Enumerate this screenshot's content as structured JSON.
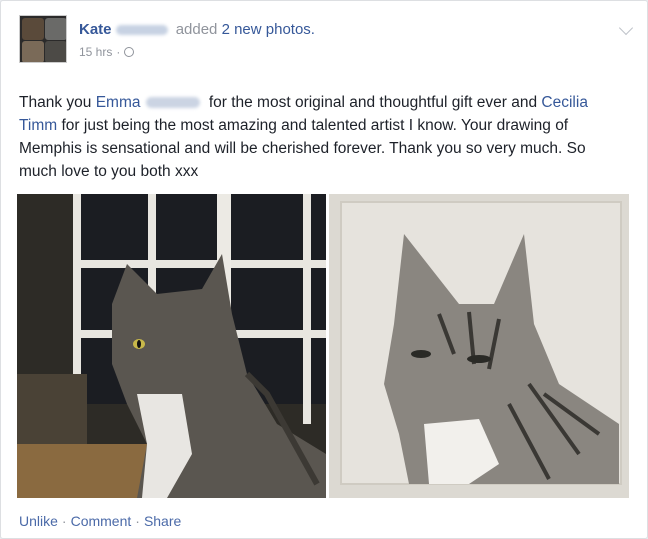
{
  "post": {
    "author": "Kate",
    "action": "added",
    "photo_count_text": "2 new photos.",
    "timestamp": "15 hrs",
    "separator": "·",
    "body_parts": {
      "p1": "Thank you",
      "tag1": "Emma",
      "p2": "for the most original and thoughtful gift ever and",
      "tag2": "Cecilia Timm",
      "p3": "for just being the most amazing and talented artist I know. Your drawing of Memphis is sensational and will be cherished forever. Thank you so very much. So much love to you both xxx"
    }
  },
  "photos": [
    {
      "subject": "tabby cat photograph"
    },
    {
      "subject": "drawing of tabby cat"
    }
  ],
  "footer": {
    "unlike": "Unlike",
    "comment": "Comment",
    "share": "Share",
    "dot": "·"
  },
  "colors": {
    "link": "#365899",
    "muted": "#90949c",
    "text": "#1d2129"
  },
  "icons": [
    "globe-icon",
    "chevron-down-icon"
  ]
}
